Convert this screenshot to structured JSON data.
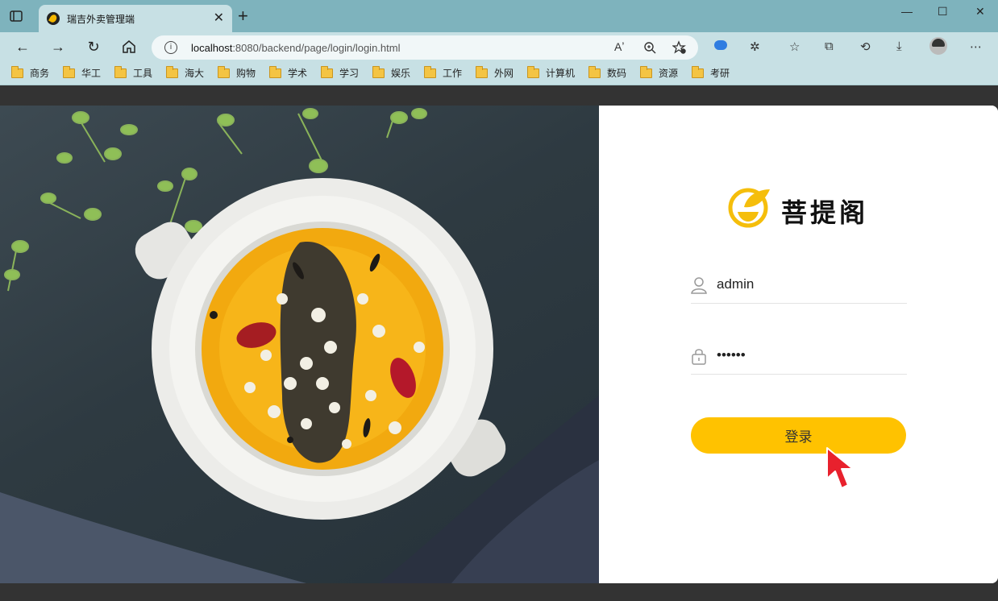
{
  "browser": {
    "tab_title": "瑞吉外卖管理端",
    "tab_close": "✕",
    "new_tab": "+",
    "url_host": "localhost",
    "url_rest": ":8080/backend/page/login/login.html",
    "window_controls": {
      "minimize": "—",
      "maximize": "☐",
      "close": "✕"
    },
    "read_aloud": "Aʼ",
    "bookmarks": [
      "商务",
      "华工",
      "工具",
      "海大",
      "购物",
      "学术",
      "学习",
      "娱乐",
      "工作",
      "外网",
      "计算机",
      "数码",
      "资源",
      "考研"
    ]
  },
  "login": {
    "brand_name": "菩提阁",
    "username_value": "admin",
    "password_value": "123456",
    "submit_label": "登录"
  },
  "colors": {
    "accent": "#ffc200",
    "browser_chrome": "#c7e0e4",
    "titlebar": "#7eb3bd"
  }
}
